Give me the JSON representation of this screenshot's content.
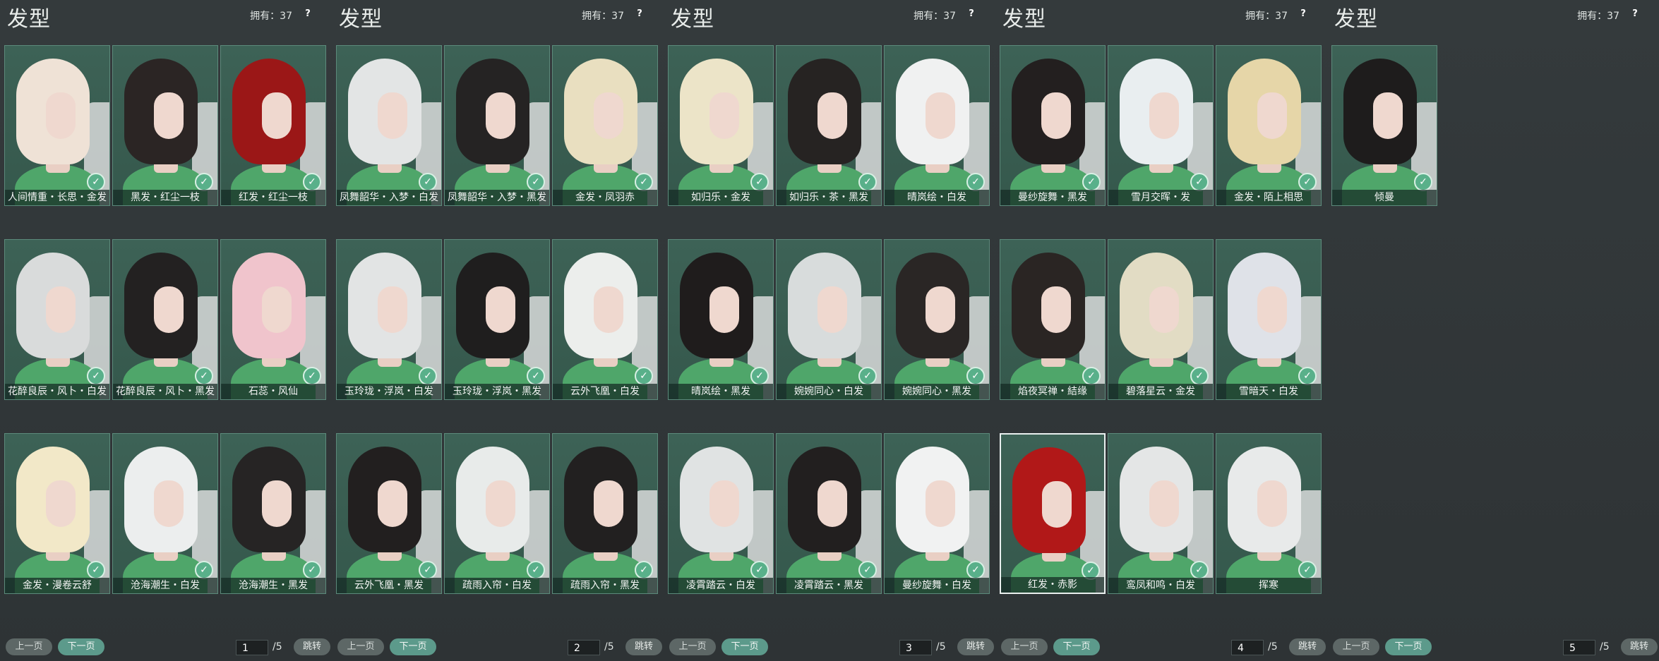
{
  "panels": [
    {
      "title": "发型",
      "owned": "拥有：37",
      "help": "?",
      "prev": "上一页",
      "next": "下一页",
      "page": "1",
      "total": "/5",
      "jump": "跳转",
      "items": [
        {
          "label": "人间情重・长思・金发",
          "hair": "#efe2d6",
          "check": true,
          "selected": false
        },
        {
          "label": "黑发・红尘一枝",
          "hair": "#2b2524",
          "check": true,
          "selected": false
        },
        {
          "label": "红发・红尘一枝",
          "hair": "#9b1717",
          "check": true,
          "selected": false
        },
        {
          "label": "花醉良辰・风卜・白发",
          "hair": "#d9dbdb",
          "check": true,
          "selected": false
        },
        {
          "label": "花醉良辰・风卜・黑发",
          "hair": "#232121",
          "check": true,
          "selected": false
        },
        {
          "label": "石蕊・风仙",
          "hair": "#f0c4cc",
          "check": true,
          "selected": false
        },
        {
          "label": "金发・漫卷云舒",
          "hair": "#f2e8c8",
          "check": true,
          "selected": false
        },
        {
          "label": "沧海潮生・白发",
          "hair": "#eceeee",
          "check": true,
          "selected": false
        },
        {
          "label": "沧海潮生・黑发",
          "hair": "#262424",
          "check": true,
          "selected": false
        }
      ]
    },
    {
      "title": "发型",
      "owned": "拥有：37",
      "help": "?",
      "prev": "上一页",
      "next": "下一页",
      "page": "2",
      "total": "/5",
      "jump": "跳转",
      "items": [
        {
          "label": "凤舞韶华・入梦・白发",
          "hair": "#e3e5e5",
          "check": true,
          "selected": false
        },
        {
          "label": "凤舞韶华・入梦・黑发",
          "hair": "#252323",
          "check": true,
          "selected": false
        },
        {
          "label": "金发・凤羽赤",
          "hair": "#e9dfc0",
          "check": true,
          "selected": false
        },
        {
          "label": "玉玲珑・浮岚・白发",
          "hair": "#e2e4e4",
          "check": true,
          "selected": false
        },
        {
          "label": "玉玲珑・浮岚・黑发",
          "hair": "#1f1e1e",
          "check": true,
          "selected": false
        },
        {
          "label": "云外飞凰・白发",
          "hair": "#eceeec",
          "check": true,
          "selected": false
        },
        {
          "label": "云外飞凰・黑发",
          "hair": "#221f1f",
          "check": true,
          "selected": false
        },
        {
          "label": "疏雨入帘・白发",
          "hair": "#e8ebea",
          "check": true,
          "selected": false
        },
        {
          "label": "疏雨入帘・黑发",
          "hair": "#222020",
          "check": true,
          "selected": false
        }
      ]
    },
    {
      "title": "发型",
      "owned": "拥有：37",
      "help": "?",
      "prev": "上一页",
      "next": "下一页",
      "page": "3",
      "total": "/5",
      "jump": "跳转",
      "items": [
        {
          "label": "如归乐・金发",
          "hair": "#ece4c8",
          "check": true,
          "selected": false
        },
        {
          "label": "如归乐・茶・黑发",
          "hair": "#262322",
          "check": true,
          "selected": false
        },
        {
          "label": "晴岚绘・白发",
          "hair": "#f0f1f1",
          "check": true,
          "selected": false
        },
        {
          "label": "晴岚绘・黑发",
          "hair": "#1f1c1c",
          "check": true,
          "selected": false
        },
        {
          "label": "婉婉同心・白发",
          "hair": "#d8dcdc",
          "check": true,
          "selected": false
        },
        {
          "label": "婉婉同心・黑发",
          "hair": "#2a2625",
          "check": true,
          "selected": false
        },
        {
          "label": "凌霄踏云・白发",
          "hair": "#e0e3e3",
          "check": true,
          "selected": false
        },
        {
          "label": "凌霄踏云・黑发",
          "hair": "#221f1f",
          "check": true,
          "selected": false
        },
        {
          "label": "曼纱旋舞・白发",
          "hair": "#f1f2f2",
          "check": true,
          "selected": false
        }
      ]
    },
    {
      "title": "发型",
      "owned": "拥有：37",
      "help": "?",
      "prev": "上一页",
      "next": "下一页",
      "page": "4",
      "total": "/5",
      "jump": "跳转",
      "items": [
        {
          "label": "曼纱旋舞・黑发",
          "hair": "#231f1f",
          "check": true,
          "selected": false
        },
        {
          "label": "雪月交晖・发",
          "hair": "#e9eef0",
          "check": true,
          "selected": false
        },
        {
          "label": "金发・陌上相思",
          "hair": "#e6d6a8",
          "check": true,
          "selected": false
        },
        {
          "label": "焰夜冥禅・結缘",
          "hair": "#2a2523",
          "check": true,
          "selected": false
        },
        {
          "label": "碧落星云・金发",
          "hair": "#e2dcc4",
          "check": true,
          "selected": false
        },
        {
          "label": "雪暗天・白发",
          "hair": "#dfe2e8",
          "check": true,
          "selected": false
        },
        {
          "label": "红发・赤影",
          "hair": "#b11818",
          "check": true,
          "selected": true
        },
        {
          "label": "鸾凤和鸣・白发",
          "hair": "#e4e6e6",
          "check": true,
          "selected": false
        },
        {
          "label": "挥寒",
          "hair": "#e8eaea",
          "check": true,
          "selected": false
        }
      ]
    },
    {
      "title": "发型",
      "owned": "拥有：37",
      "help": "?",
      "prev": "上一页",
      "next": "下一页",
      "page": "5",
      "total": "/5",
      "jump": "跳转",
      "items": [
        {
          "label": "倾曼",
          "hair": "#1e1c1c",
          "check": true,
          "selected": false
        }
      ]
    }
  ]
}
